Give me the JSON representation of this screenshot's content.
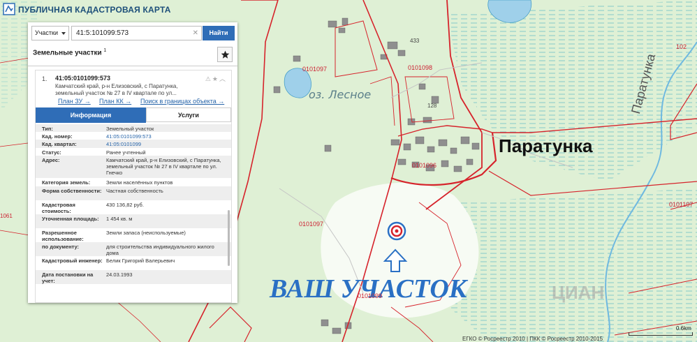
{
  "app": {
    "title": "ПУБЛИЧНАЯ КАДАСТРОВАЯ КАРТА"
  },
  "search": {
    "type_label": "Участки",
    "query": "41:5:101099:573",
    "button_label": "Найти"
  },
  "panel": {
    "section_title": "Земельные участки",
    "section_count": "1"
  },
  "result": {
    "number": "1.",
    "id": "41:05:0101099:573",
    "address_lines": [
      "Камчатский край, р-н Елизовский, с Паратунка,",
      "земельный участок № 27 в IV квартале по ул..."
    ],
    "links": {
      "plan_zu": "План ЗУ →",
      "plan_kk": "План КК →",
      "search_bounds": "Поиск в границах объекта →"
    },
    "tabs": {
      "info": "Информация",
      "services": "Услуги"
    }
  },
  "properties": [
    {
      "key": "Тип:",
      "value": "Земельный участок",
      "link": false
    },
    {
      "key": "Кад. номер:",
      "value": "41:05:0101099:573",
      "link": true
    },
    {
      "key": "Кад. квартал:",
      "value": "41:05:0101099",
      "link": true
    },
    {
      "key": "Статус:",
      "value": "Ранее учтенный",
      "link": false
    },
    {
      "key": "Адрес:",
      "value": "Камчатский край, р-н Елизовский, с Паратунка, земельный участок № 27 в IV квартале по ул. Гнечко",
      "link": false
    },
    {
      "key": "Категория земель:",
      "value": "Земли населённых пунктов",
      "link": false
    },
    {
      "key": "Форма собственности:",
      "value": "Частная собственность",
      "link": false
    },
    {
      "key": "Кадастровая стоимость:",
      "value": "430 136,82 руб.",
      "link": false
    },
    {
      "key": "Уточненная площадь:",
      "value": "1 454 кв. м",
      "link": false
    },
    {
      "key": "Разрешенное использование:",
      "value": "Земли запаса (неиспользуемые)",
      "link": false
    },
    {
      "key": "по документу:",
      "value": "для строительства индивидуального жилого дома",
      "link": false
    },
    {
      "key": "Кадастровый инженер:",
      "value": "Белик Григорий Валерьевич",
      "link": false
    },
    {
      "key": "Дата постановки на учет:",
      "value": "24.03.1993",
      "link": false
    }
  ],
  "map": {
    "labels": {
      "lake": "оз. Лесное",
      "village": "Паратунка",
      "river": "Паратунка",
      "your_plot": "ВАШ УЧАСТОК",
      "q_0101097_a": "0101097",
      "q_0101097_b": "0101097",
      "q_0101098": "0101098",
      "q_0101096": "0101096",
      "q_0101099": "0101099",
      "q_0101107": "0101107",
      "q_1061": "1061",
      "q_102": "102",
      "n_433": "433",
      "n_128": "128",
      "scale": "0.6km",
      "copyright": "ЕГКО © Росреестр 2010 | ПКК © Росреестр 2010-2015",
      "watermark": "ЦИАН"
    }
  },
  "colors": {
    "accent": "#2f6db7",
    "boundary": "#d6232b",
    "forest": "#dff0d5",
    "clearing": "#f7fbf4",
    "marker_title": "#2a70c4"
  }
}
